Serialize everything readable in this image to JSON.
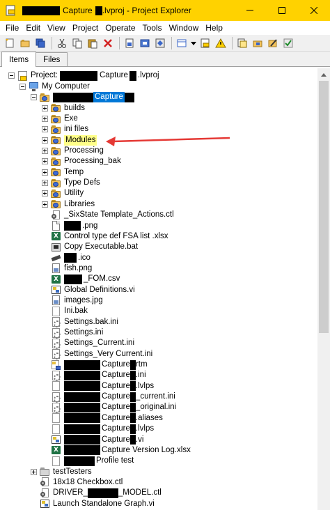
{
  "window": {
    "title_prefix": "",
    "title_mid": "Capture",
    "title_suffix": ".lvproj - Project Explorer",
    "colors": {
      "titlebar": "#ffd200",
      "selection": "#0078d7",
      "highlight": "#ffff88",
      "arrow": "#e53935"
    }
  },
  "menu": [
    "File",
    "Edit",
    "View",
    "Project",
    "Operate",
    "Tools",
    "Window",
    "Help"
  ],
  "toolbar": {
    "icons": [
      "new-icon",
      "open-icon",
      "save-all-icon",
      "cut-icon",
      "copy-icon",
      "paste-icon",
      "delete-icon",
      "add-file-icon",
      "build-icon",
      "deploy-icon",
      "view-icon",
      "dropdown-icon",
      "project-icon",
      "warning-icon",
      "files-icon",
      "folder-icon",
      "edit-icon",
      "check-icon"
    ]
  },
  "tabs": [
    "Items",
    "Files"
  ],
  "tree": {
    "project": {
      "prefix": "Project:",
      "mid": "Capture",
      "suffix": ".lvproj"
    },
    "my_computer": "My Computer",
    "target": "Capture",
    "items": [
      {
        "label": "builds",
        "icon": "folder"
      },
      {
        "label": "Exe",
        "icon": "folder"
      },
      {
        "label": "ini files",
        "icon": "folder"
      },
      {
        "label": "Modules",
        "icon": "folder",
        "highlight": true
      },
      {
        "label": "Processing",
        "icon": "folder"
      },
      {
        "label": "Processing_bak",
        "icon": "folder"
      },
      {
        "label": "Temp",
        "icon": "folder"
      },
      {
        "label": "Type Defs",
        "icon": "folder"
      },
      {
        "label": "Utility",
        "icon": "folder"
      },
      {
        "label": "Libraries",
        "icon": "folder"
      },
      {
        "label": "_SixState Template_Actions.ctl",
        "icon": "ctl"
      },
      {
        "label": ".png",
        "icon": "doc",
        "redact_prefix": true
      },
      {
        "label": "Control type def FSA list .xlsx",
        "icon": "xls"
      },
      {
        "label": "Copy Executable.bat",
        "icon": "bat"
      },
      {
        "label": ".ico",
        "icon": "ico",
        "redact_prefix": true
      },
      {
        "label": "fish.png",
        "icon": "img"
      },
      {
        "label": "_FOM.csv",
        "icon": "xls",
        "redact_prefix": true
      },
      {
        "label": "Global Definitions.vi",
        "icon": "vi"
      },
      {
        "label": "images.jpg",
        "icon": "img"
      },
      {
        "label": "Ini.bak",
        "icon": "blank"
      },
      {
        "label": "Settings.bak.ini",
        "icon": "gear"
      },
      {
        "label": "Settings.ini",
        "icon": "gear"
      },
      {
        "label": "Settings_Current.ini",
        "icon": "gear"
      },
      {
        "label": "Settings_Very Current.ini",
        "icon": "gear"
      },
      {
        "label": "Capture",
        "tail": "rtm",
        "icon": "badge",
        "redact_prefix": true
      },
      {
        "label": "Capture",
        "tail": ".ini",
        "icon": "gear",
        "redact_prefix": true
      },
      {
        "label": "Capture",
        "tail": ".lvlps",
        "icon": "blank",
        "redact_prefix": true
      },
      {
        "label": "Capture",
        "tail": "_current.ini",
        "icon": "gear",
        "redact_prefix": true
      },
      {
        "label": "Capture",
        "tail": "_original.ini",
        "icon": "gear",
        "redact_prefix": true
      },
      {
        "label": "Capture",
        "tail": ".aliases",
        "icon": "blank",
        "redact_prefix": true
      },
      {
        "label": "Capture",
        "tail": ".lvlps",
        "icon": "blank",
        "redact_prefix": true
      },
      {
        "label": "Capture",
        "tail": ".vi",
        "icon": "vi",
        "redact_prefix": true
      },
      {
        "label": "Capture Version Log.xlsx",
        "icon": "xls",
        "redact_prefix": true
      },
      {
        "label": "Profile test",
        "icon": "blank",
        "redact_prefix": true
      }
    ],
    "after": [
      {
        "label": "testTesters",
        "icon": "folder-plain",
        "expander": true
      },
      {
        "label": "18x18 Checkbox.ctl",
        "icon": "ctl"
      },
      {
        "label": "DRIVER_",
        "tail": "_MODEL.ctl",
        "icon": "ctl",
        "redact_mid": true
      },
      {
        "label": "Launch Standalone Graph.vi",
        "icon": "vi"
      }
    ]
  }
}
